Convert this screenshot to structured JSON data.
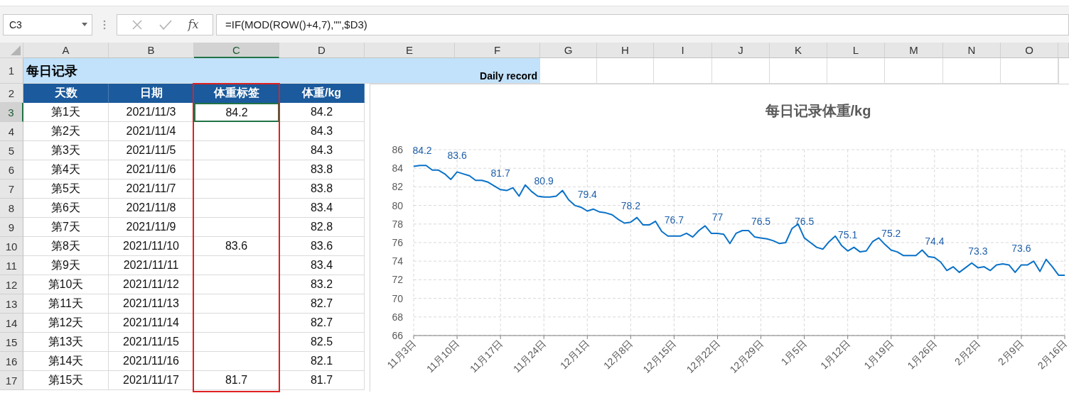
{
  "name_box": "C3",
  "function_label": "fx",
  "formula": "=IF(MOD(ROW()+4,7),\"\",$D3)",
  "columns": [
    {
      "label": "A",
      "selected": false
    },
    {
      "label": "B",
      "selected": false
    },
    {
      "label": "C",
      "selected": true
    },
    {
      "label": "D",
      "selected": false
    },
    {
      "label": "E",
      "selected": false
    },
    {
      "label": "F",
      "selected": false
    },
    {
      "label": "G",
      "selected": false
    },
    {
      "label": "H",
      "selected": false
    },
    {
      "label": "I",
      "selected": false
    },
    {
      "label": "J",
      "selected": false
    },
    {
      "label": "K",
      "selected": false
    },
    {
      "label": "L",
      "selected": false
    },
    {
      "label": "M",
      "selected": false
    },
    {
      "label": "N",
      "selected": false
    },
    {
      "label": "O",
      "selected": false
    }
  ],
  "row_numbers": [
    {
      "label": "1",
      "selected": false
    },
    {
      "label": "2",
      "selected": false
    },
    {
      "label": "3",
      "selected": true
    },
    {
      "label": "4",
      "selected": false
    },
    {
      "label": "5",
      "selected": false
    },
    {
      "label": "6",
      "selected": false
    },
    {
      "label": "7",
      "selected": false
    },
    {
      "label": "8",
      "selected": false
    },
    {
      "label": "9",
      "selected": false
    },
    {
      "label": "10",
      "selected": false
    },
    {
      "label": "11",
      "selected": false
    },
    {
      "label": "12",
      "selected": false
    },
    {
      "label": "13",
      "selected": false
    },
    {
      "label": "14",
      "selected": false
    },
    {
      "label": "15",
      "selected": false
    },
    {
      "label": "16",
      "selected": false
    },
    {
      "label": "17",
      "selected": false
    }
  ],
  "title_row": {
    "title": "每日记录",
    "subtitle": "Daily record"
  },
  "header": [
    "天数",
    "日期",
    "体重标签",
    "体重/kg"
  ],
  "rows": [
    {
      "day": "第1天",
      "date": "2021/11/3",
      "label": "84.2",
      "weight": "84.2",
      "selected": true
    },
    {
      "day": "第2天",
      "date": "2021/11/4",
      "weight": "84.3",
      "selected": false
    },
    {
      "day": "第3天",
      "date": "2021/11/5",
      "weight": "84.3",
      "selected": false
    },
    {
      "day": "第4天",
      "date": "2021/11/6",
      "weight": "83.8",
      "selected": false
    },
    {
      "day": "第5天",
      "date": "2021/11/7",
      "weight": "83.8",
      "selected": false
    },
    {
      "day": "第6天",
      "date": "2021/11/8",
      "weight": "83.4",
      "selected": false
    },
    {
      "day": "第7天",
      "date": "2021/11/9",
      "weight": "82.8",
      "selected": false
    },
    {
      "day": "第8天",
      "date": "2021/11/10",
      "label": "83.6",
      "weight": "83.6",
      "selected": false
    },
    {
      "day": "第9天",
      "date": "2021/11/11",
      "weight": "83.4",
      "selected": false
    },
    {
      "day": "第10天",
      "date": "2021/11/12",
      "weight": "83.2",
      "selected": false
    },
    {
      "day": "第11天",
      "date": "2021/11/13",
      "weight": "82.7",
      "selected": false
    },
    {
      "day": "第12天",
      "date": "2021/11/14",
      "weight": "82.7",
      "selected": false
    },
    {
      "day": "第13天",
      "date": "2021/11/15",
      "weight": "82.5",
      "selected": false
    },
    {
      "day": "第14天",
      "date": "2021/11/16",
      "weight": "82.1",
      "selected": false
    },
    {
      "day": "第15天",
      "date": "2021/11/17",
      "label": "81.7",
      "weight": "81.7",
      "selected": false
    }
  ],
  "chart": {
    "chart_data": {
      "type": "line",
      "title": "每日记录体重/kg",
      "categories": [
        "11月3日",
        null,
        null,
        null,
        null,
        null,
        null,
        "11月10日",
        null,
        null,
        null,
        null,
        null,
        null,
        "11月17日",
        null,
        null,
        null,
        null,
        null,
        null,
        "11月24日",
        null,
        null,
        null,
        null,
        null,
        null,
        "12月1日",
        null,
        null,
        null,
        null,
        null,
        null,
        "12月8日",
        null,
        null,
        null,
        null,
        null,
        null,
        "12月15日",
        null,
        null,
        null,
        null,
        null,
        null,
        "12月22日",
        null,
        null,
        null,
        null,
        null,
        null,
        "12月29日",
        null,
        null,
        null,
        null,
        null,
        null,
        "1月5日",
        null,
        null,
        null,
        null,
        null,
        null,
        "1月12日",
        null,
        null,
        null,
        null,
        null,
        null,
        "1月19日",
        null,
        null,
        null,
        null,
        null,
        null,
        "1月26日",
        null,
        null,
        null,
        null,
        null,
        null,
        "2月2日",
        null,
        null,
        null,
        null,
        null,
        null,
        "2月9日",
        null,
        null,
        null,
        null,
        null,
        null,
        "2月16日"
      ],
      "grid": true,
      "series": [
        {
          "color": "#0a72c8",
          "values": [
            84.2,
            84.3,
            84.3,
            83.8,
            83.8,
            83.4,
            82.8,
            83.6,
            83.4,
            83.2,
            82.7,
            82.7,
            82.5,
            82.1,
            81.7,
            81.6,
            81.9,
            81.0,
            82.2,
            81.5,
            81.0,
            80.9,
            80.9,
            81.0,
            81.6,
            80.6,
            80.0,
            79.8,
            79.4,
            79.6,
            79.3,
            79.2,
            79.0,
            78.5,
            78.1,
            78.2,
            78.7,
            77.9,
            77.9,
            78.3,
            77.2,
            76.7,
            76.7,
            76.7,
            77.0,
            76.6,
            77.3,
            77.8,
            77.0,
            77.0,
            76.9,
            75.9,
            77.0,
            77.3,
            77.3,
            76.6,
            76.5,
            76.4,
            76.2,
            75.9,
            76.0,
            77.5,
            78.0,
            76.5,
            76.0,
            75.5,
            75.3,
            76.1,
            76.7,
            75.7,
            75.1,
            75.5,
            75.0,
            75.1,
            76.1,
            76.5,
            75.8,
            75.2,
            75.0,
            74.6,
            74.6,
            74.6,
            75.2,
            74.5,
            74.4,
            73.9,
            73.0,
            73.4,
            72.8,
            73.3,
            73.8,
            73.3,
            73.4,
            73.0,
            73.6,
            73.7,
            73.6,
            72.8,
            73.6,
            73.6,
            74.0,
            72.9,
            74.2,
            73.4,
            72.5,
            72.5
          ]
        }
      ],
      "ylim": [
        66,
        86
      ],
      "yticks": [
        66,
        68,
        70,
        72,
        74,
        76,
        78,
        80,
        82,
        84,
        86
      ],
      "annotations": [
        {
          "x": "11月3日",
          "y": 84.2,
          "text": "84.2"
        },
        {
          "x": "11月10日",
          "y": 83.6,
          "text": "83.6"
        },
        {
          "x": "11月17日",
          "y": 81.7,
          "text": "81.7"
        },
        {
          "x": "11月24日",
          "y": 80.9,
          "text": "80.9"
        },
        {
          "x": "12月1日",
          "y": 79.4,
          "text": "79.4"
        },
        {
          "x": "12月8日",
          "y": 78.2,
          "text": "78.2"
        },
        {
          "x": "12月15日",
          "y": 76.7,
          "text": "76.7"
        },
        {
          "x": "12月22日",
          "y": 77,
          "text": "77"
        },
        {
          "x": "12月29日",
          "y": 76.5,
          "text": "76.5"
        },
        {
          "x": "1月5日",
          "y": 76.5,
          "text": "76.5"
        },
        {
          "x": "1月12日",
          "y": 75.1,
          "text": "75.1"
        },
        {
          "x": "1月19日",
          "y": 75.2,
          "text": "75.2"
        },
        {
          "x": "1月26日",
          "y": 74.4,
          "text": "74.4"
        },
        {
          "x": "2月2日",
          "y": 73.3,
          "text": "73.3"
        },
        {
          "x": "2月9日",
          "y": 73.6,
          "text": "73.6"
        }
      ]
    }
  }
}
